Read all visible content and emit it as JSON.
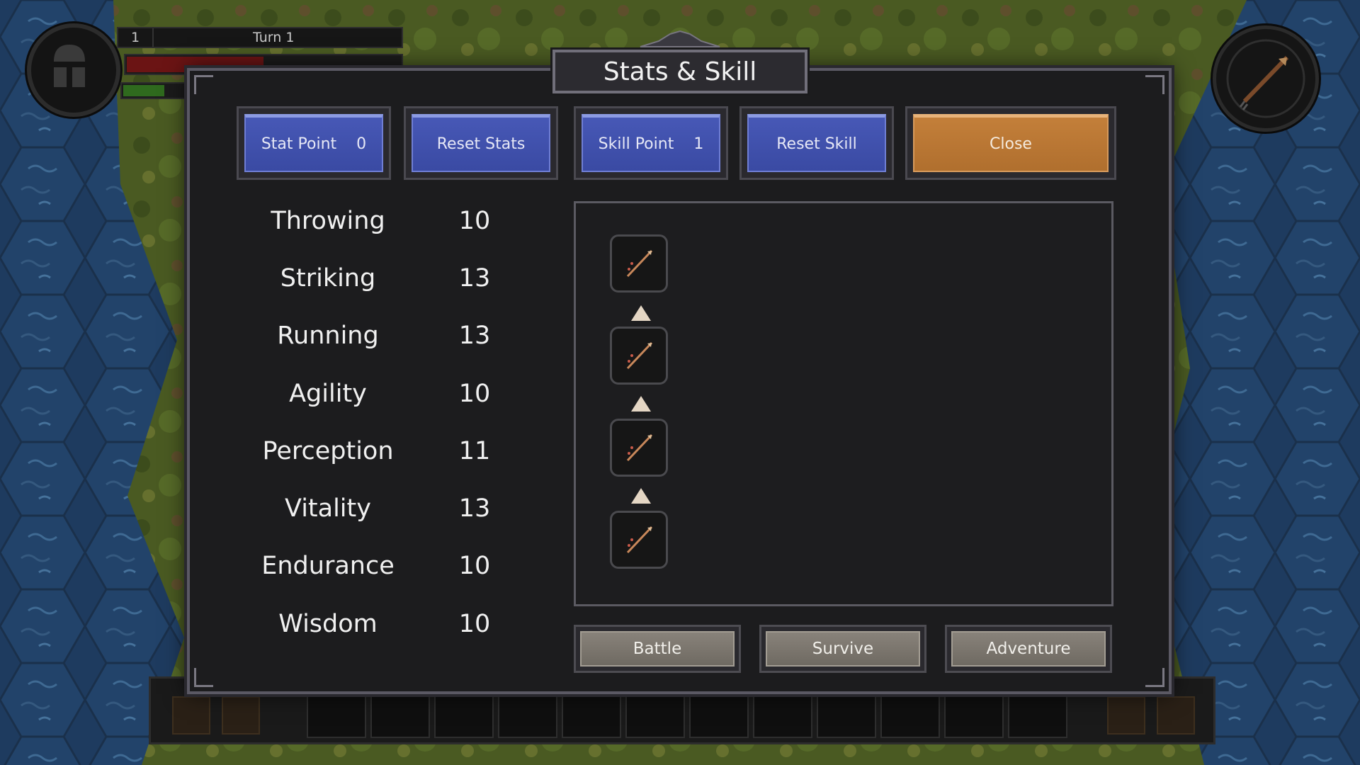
{
  "hud": {
    "turn_number": "1",
    "turn_label": "Turn 1",
    "health_level": 0.5,
    "stamina_level": 0.6,
    "portrait_icon": "knight-helmet-icon",
    "compass_icon": "compass-arrow-icon"
  },
  "dialog": {
    "title": "Stats & Skill",
    "buttons": {
      "stat_point_label": "Stat Point",
      "stat_point_value": "0",
      "reset_stats": "Reset Stats",
      "skill_point_label": "Skill Point",
      "skill_point_value": "1",
      "reset_skill": "Reset Skill",
      "close": "Close"
    },
    "stats": [
      {
        "name": "Throwing",
        "value": "10"
      },
      {
        "name": "Striking",
        "value": "13"
      },
      {
        "name": "Running",
        "value": "13"
      },
      {
        "name": "Agility",
        "value": "10"
      },
      {
        "name": "Perception",
        "value": "11"
      },
      {
        "name": "Vitality",
        "value": "13"
      },
      {
        "name": "Endurance",
        "value": "10"
      },
      {
        "name": "Wisdom",
        "value": "10"
      }
    ],
    "skill_tree": {
      "icon": "spear-throw-icon",
      "tiers": 4
    },
    "categories": {
      "battle": "Battle",
      "survive": "Survive",
      "adventure": "Adventure"
    }
  },
  "colors": {
    "button_blue": "#4252ad",
    "button_orange": "#bb7a36",
    "category_grey": "#7d7870",
    "dialog_bg": "#1c1c1e"
  }
}
